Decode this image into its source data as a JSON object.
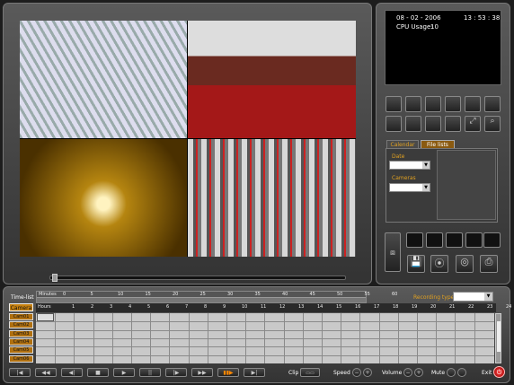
{
  "status": {
    "date": "08 - 02 - 2006",
    "time": "13 : 53 : 38",
    "cpu_label": "CPU Usage:",
    "cpu_value": "10"
  },
  "tabs": {
    "calendar": "Calendar",
    "file_lists": "File lists"
  },
  "fields": {
    "date_label": "Date",
    "cameras_label": "Cameras"
  },
  "timeline": {
    "time_list_label": "Time-list",
    "minutes_label": "Minutes",
    "hours_label": "Hours",
    "minute_ticks": [
      "0",
      "5",
      "10",
      "15",
      "20",
      "25",
      "30",
      "35",
      "40",
      "45",
      "50",
      "55",
      "60"
    ],
    "hour_ticks": [
      "1",
      "2",
      "3",
      "4",
      "5",
      "6",
      "7",
      "8",
      "9",
      "10",
      "11",
      "12",
      "13",
      "14",
      "15",
      "16",
      "17",
      "18",
      "19",
      "20",
      "21",
      "22",
      "23",
      "24"
    ],
    "recording_type_label": "Recording type",
    "camera_label": "Camera",
    "cameras": [
      "Cam01",
      "Cam02",
      "Cam03",
      "Cam04",
      "Cam05",
      "Cam06"
    ]
  },
  "controls": {
    "clip": "Clip",
    "speed": "Speed",
    "volume": "Volume",
    "mute": "Mute",
    "exit": "Exit"
  }
}
